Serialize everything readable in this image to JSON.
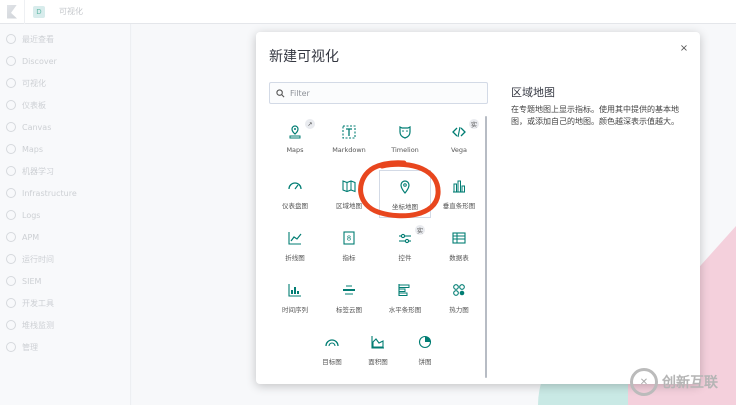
{
  "app": {
    "breadcrumb": "可视化",
    "space_initial": "D"
  },
  "sidebar": {
    "items": [
      {
        "label": "最近查看",
        "icon": "clock-icon"
      },
      {
        "label": "Discover",
        "icon": "compass-icon"
      },
      {
        "label": "可视化",
        "icon": "visualize-icon"
      },
      {
        "label": "仪表板",
        "icon": "dashboard-icon"
      },
      {
        "label": "Canvas",
        "icon": "canvas-icon"
      },
      {
        "label": "Maps",
        "icon": "maps-icon"
      },
      {
        "label": "机器学习",
        "icon": "ml-icon"
      },
      {
        "label": "Infrastructure",
        "icon": "infrastructure-icon"
      },
      {
        "label": "Logs",
        "icon": "logs-icon"
      },
      {
        "label": "APM",
        "icon": "apm-icon"
      },
      {
        "label": "运行时间",
        "icon": "uptime-icon"
      },
      {
        "label": "SIEM",
        "icon": "siem-icon"
      },
      {
        "label": "开发工具",
        "icon": "devtools-icon"
      },
      {
        "label": "堆栈监测",
        "icon": "monitoring-icon"
      },
      {
        "label": "管理",
        "icon": "gear-icon"
      }
    ]
  },
  "modal": {
    "title": "新建可视化",
    "close_symbol": "×",
    "search_placeholder": "Filter",
    "cards": [
      {
        "label": "Maps",
        "icon": "maps-icon",
        "badge": "↗"
      },
      {
        "label": "Markdown",
        "icon": "markdown-icon"
      },
      {
        "label": "Timelion",
        "icon": "timelion-icon"
      },
      {
        "label": "Vega",
        "icon": "vega-icon",
        "badge": "实"
      },
      {
        "label": "仪表盘图",
        "icon": "gauge-icon"
      },
      {
        "label": "区域地图",
        "icon": "region-map-icon"
      },
      {
        "label": "坐标地图",
        "icon": "coordinate-map-icon"
      },
      {
        "label": "垂直条形图",
        "icon": "vertical-bar-icon"
      },
      {
        "label": "折线图",
        "icon": "line-chart-icon"
      },
      {
        "label": "指标",
        "icon": "metric-icon"
      },
      {
        "label": "控件",
        "icon": "controls-icon",
        "badge": "实"
      },
      {
        "label": "数据表",
        "icon": "data-table-icon"
      },
      {
        "label": "时间序列",
        "icon": "timeseries-icon"
      },
      {
        "label": "标签云图",
        "icon": "tag-cloud-icon"
      },
      {
        "label": "水平条形图",
        "icon": "horizontal-bar-icon"
      },
      {
        "label": "热力图",
        "icon": "heatmap-icon"
      },
      {
        "label": "目标图",
        "icon": "goal-icon"
      },
      {
        "label": "面积图",
        "icon": "area-chart-icon"
      },
      {
        "label": "饼图",
        "icon": "pie-chart-icon"
      }
    ],
    "side_title": "区域地图",
    "side_description": "在专题地图上显示指标。使用其中提供的基本地图，或添加自己的地图。颜色越深表示值越大。"
  },
  "colors": {
    "accent": "#006BB4",
    "icon_teal": "#017D73",
    "marker": "#E8461E"
  },
  "watermark": {
    "text": "创新互联"
  }
}
